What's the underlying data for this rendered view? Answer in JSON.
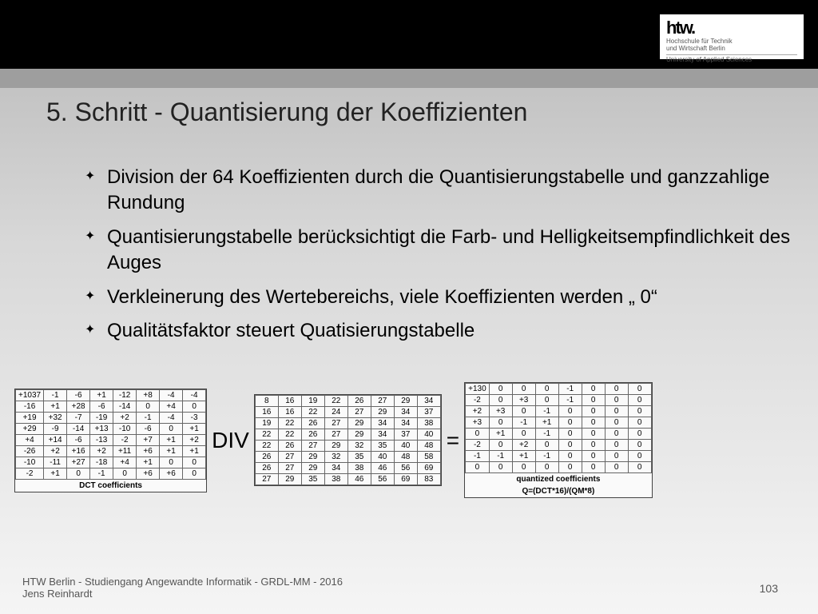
{
  "logo": {
    "mark": "htw.",
    "line1": "Hochschule für Technik",
    "line2": "und Wirtschaft Berlin",
    "line3": "University of Applied Sciences"
  },
  "title": "5. Schritt - Quantisierung der Koeffizienten",
  "bullets": [
    "Division der 64 Koeffizienten durch die Quantisierungstabelle und ganzzahlige Rundung",
    "Quantisierungstabelle berücksichtigt die Farb- und Helligkeitsempfindlichkeit des Auges",
    "Verkleinerung des Wertebereichs, viele Koeffizienten werden „ 0“",
    "Qualitätsfaktor steuert Quatisierungstabelle"
  ],
  "op_div": "DIV",
  "op_eq": "=",
  "m1": {
    "caption": "DCT coefficients",
    "rows": [
      [
        "+1037",
        "-1",
        "-6",
        "+1",
        "-12",
        "+8",
        "-4",
        "-4"
      ],
      [
        "-16",
        "+1",
        "+28",
        "-6",
        "-14",
        "0",
        "+4",
        "0"
      ],
      [
        "+19",
        "+32",
        "-7",
        "-19",
        "+2",
        "-1",
        "-4",
        "-3"
      ],
      [
        "+29",
        "-9",
        "-14",
        "+13",
        "-10",
        "-6",
        "0",
        "+1"
      ],
      [
        "+4",
        "+14",
        "-6",
        "-13",
        "-2",
        "+7",
        "+1",
        "+2"
      ],
      [
        "-26",
        "+2",
        "+16",
        "+2",
        "+11",
        "+6",
        "+1",
        "+1"
      ],
      [
        "-10",
        "-11",
        "+27",
        "-18",
        "+4",
        "+1",
        "0",
        "0"
      ],
      [
        "-2",
        "+1",
        "0",
        "-1",
        "0",
        "+6",
        "+6",
        "0"
      ]
    ]
  },
  "m2": {
    "rows": [
      [
        "8",
        "16",
        "19",
        "22",
        "26",
        "27",
        "29",
        "34"
      ],
      [
        "16",
        "16",
        "22",
        "24",
        "27",
        "29",
        "34",
        "37"
      ],
      [
        "19",
        "22",
        "26",
        "27",
        "29",
        "34",
        "34",
        "38"
      ],
      [
        "22",
        "22",
        "26",
        "27",
        "29",
        "34",
        "37",
        "40"
      ],
      [
        "22",
        "26",
        "27",
        "29",
        "32",
        "35",
        "40",
        "48"
      ],
      [
        "26",
        "27",
        "29",
        "32",
        "35",
        "40",
        "48",
        "58"
      ],
      [
        "26",
        "27",
        "29",
        "34",
        "38",
        "46",
        "56",
        "69"
      ],
      [
        "27",
        "29",
        "35",
        "38",
        "46",
        "56",
        "69",
        "83"
      ]
    ]
  },
  "m3": {
    "caption": "quantized coefficients",
    "formula": "Q=(DCT*16)/(QM*8)",
    "rows": [
      [
        "+130",
        "0",
        "0",
        "0",
        "-1",
        "0",
        "0",
        "0"
      ],
      [
        "-2",
        "0",
        "+3",
        "0",
        "-1",
        "0",
        "0",
        "0"
      ],
      [
        "+2",
        "+3",
        "0",
        "-1",
        "0",
        "0",
        "0",
        "0"
      ],
      [
        "+3",
        "0",
        "-1",
        "+1",
        "0",
        "0",
        "0",
        "0"
      ],
      [
        "0",
        "+1",
        "0",
        "-1",
        "0",
        "0",
        "0",
        "0"
      ],
      [
        "-2",
        "0",
        "+2",
        "0",
        "0",
        "0",
        "0",
        "0"
      ],
      [
        "-1",
        "-1",
        "+1",
        "-1",
        "0",
        "0",
        "0",
        "0"
      ],
      [
        "0",
        "0",
        "0",
        "0",
        "0",
        "0",
        "0",
        "0"
      ]
    ]
  },
  "footer": {
    "l1": "HTW Berlin - Studiengang Angewandte Informatik - GRDL-MM - 2016",
    "l2": "Jens Reinhardt"
  },
  "page": "103"
}
